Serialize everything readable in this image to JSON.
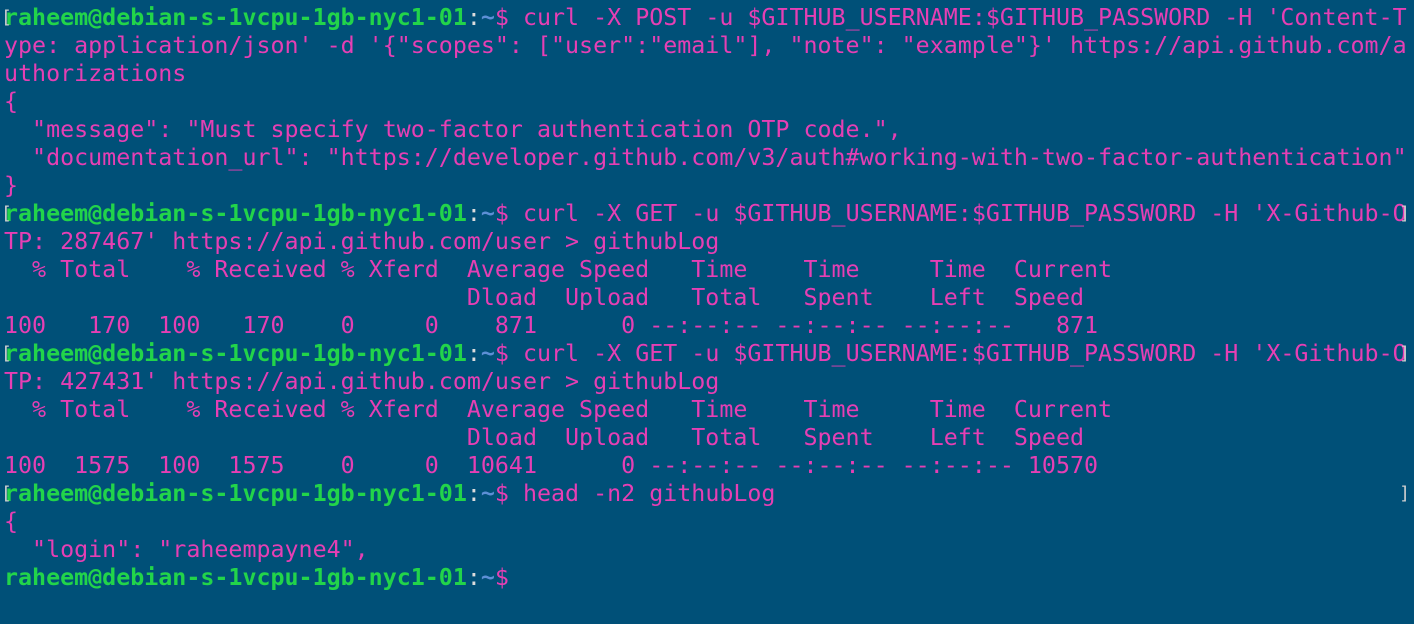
{
  "terminal": {
    "colors": {
      "background": "#005078",
      "text": "#e63fb4",
      "prompt_user": "#22d44a",
      "prompt_path": "#5c8fd6"
    },
    "prompt": {
      "user_host": "raheem@debian-s-1vcpu-1gb-nyc1-01",
      "sep": ":",
      "path": "~",
      "dollar": "$ "
    },
    "lines": [
      {
        "kind": "prompt",
        "text": "curl -X POST -u $GITHUB_USERNAME:$GITHUB_PASSWORD -H 'Content-T",
        "bracket": true
      },
      {
        "kind": "out",
        "text": "ype: application/json' -d '{\"scopes\": [\"user\":\"email\"], \"note\": \"example\"}' https://api.github.com/a"
      },
      {
        "kind": "out",
        "text": "uthorizations"
      },
      {
        "kind": "out",
        "text": "{"
      },
      {
        "kind": "out",
        "text": "  \"message\": \"Must specify two-factor authentication OTP code.\","
      },
      {
        "kind": "out",
        "text": "  \"documentation_url\": \"https://developer.github.com/v3/auth#working-with-two-factor-authentication\""
      },
      {
        "kind": "out",
        "text": "}"
      },
      {
        "kind": "prompt",
        "text": "curl -X GET -u $GITHUB_USERNAME:$GITHUB_PASSWORD -H 'X-Github-O",
        "bracket": true,
        "wrap": true
      },
      {
        "kind": "out",
        "text": "TP: 287467' https://api.github.com/user > githubLog"
      },
      {
        "kind": "out",
        "text": "  % Total    % Received % Xferd  Average Speed   Time    Time     Time  Current"
      },
      {
        "kind": "out",
        "text": "                                 Dload  Upload   Total   Spent    Left  Speed"
      },
      {
        "kind": "out",
        "text": "100   170  100   170    0     0    871      0 --:--:-- --:--:-- --:--:--   871"
      },
      {
        "kind": "prompt",
        "text": "curl -X GET -u $GITHUB_USERNAME:$GITHUB_PASSWORD -H 'X-Github-O",
        "bracket": true,
        "wrap": true
      },
      {
        "kind": "out",
        "text": "TP: 427431' https://api.github.com/user > githubLog"
      },
      {
        "kind": "out",
        "text": "  % Total    % Received % Xferd  Average Speed   Time    Time     Time  Current"
      },
      {
        "kind": "out",
        "text": "                                 Dload  Upload   Total   Spent    Left  Speed"
      },
      {
        "kind": "out",
        "text": "100  1575  100  1575    0     0  10641      0 --:--:-- --:--:-- --:--:-- 10570"
      },
      {
        "kind": "prompt",
        "text": "head -n2 githubLog",
        "bracket": true,
        "wrap": true
      },
      {
        "kind": "out",
        "text": "{"
      },
      {
        "kind": "out",
        "text": "  \"login\": \"raheempayne4\","
      },
      {
        "kind": "prompt",
        "text": "",
        "bracket": false
      }
    ]
  }
}
